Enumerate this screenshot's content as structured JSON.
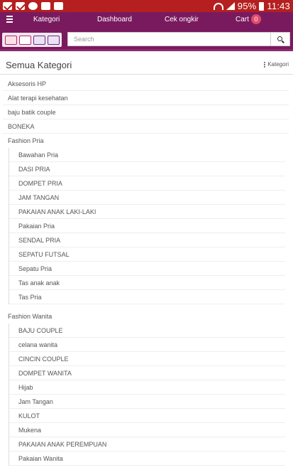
{
  "status_bar": {
    "battery": "95%",
    "time": "11:43",
    "icons": [
      "gmail-icon",
      "gmail-icon",
      "whatsapp-icon",
      "download-icon",
      "photo-icon",
      "wifi-icon",
      "signal-icon",
      "battery-icon"
    ]
  },
  "nav": {
    "menu_icon": "hamburger-icon",
    "kategori": "Kategori",
    "dashboard": "Dashboard",
    "cek_ongkir": "Cek ongkir",
    "cart_label": "Cart",
    "cart_count": "0"
  },
  "search": {
    "placeholder": "Search",
    "value": "",
    "icon": "search-icon"
  },
  "header": {
    "title": "Semua Kategori",
    "link": "Kategori"
  },
  "categories": [
    "Aksesoris HP",
    "Alat terapi kesehatan",
    "baju batik couple",
    "BONEKA",
    "Fashion Pria"
  ],
  "fashion_pria": [
    "Bawahan Pria",
    "DASI PRIA",
    "DOMPET PRIA",
    "JAM TANGAN",
    "PAKAIAN ANAK LAKI-LAKI",
    "Pakaian Pria",
    "SENDAL PRIA",
    "SEPATU FUTSAL",
    "Sepatu Pria",
    "Tas anak anak",
    "Tas Pria"
  ],
  "fashion_wanita_label": "Fashion Wanita",
  "fashion_wanita": [
    "BAJU COUPLE",
    "celana wanita",
    "CINCIN COUPLE",
    "DOMPET WANITA",
    "Hijab",
    "Jam Tangan",
    "KULOT",
    "Mukena",
    "PAKAIAN ANAK PEREMPUAN",
    "Pakaian Wanita"
  ],
  "colors": {
    "status_bar": "#b51f1f",
    "nav": "#7a1a5e",
    "badge": "#e04a6a"
  }
}
